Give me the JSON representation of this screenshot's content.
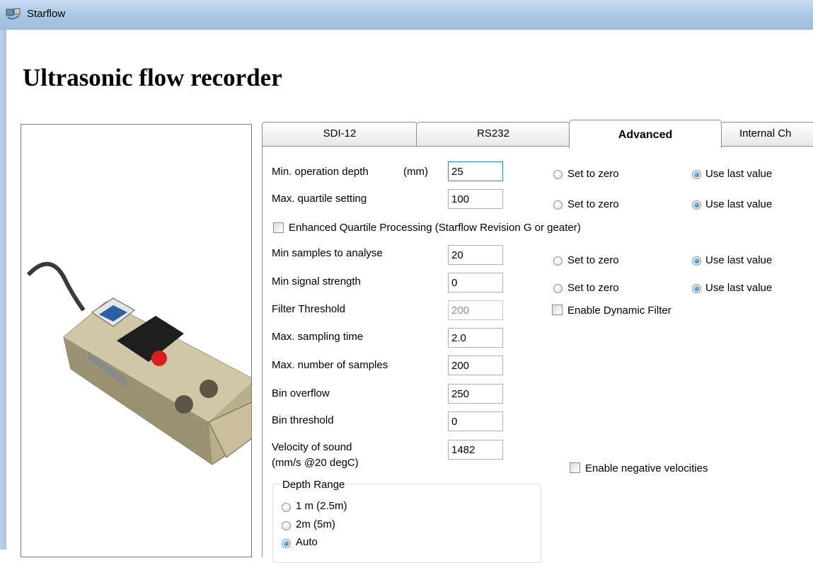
{
  "window": {
    "title": "Starflow"
  },
  "page": {
    "heading": "Ultrasonic flow recorder"
  },
  "tabs": [
    {
      "label": "SDI-12"
    },
    {
      "label": "RS232"
    },
    {
      "label": "Advanced"
    },
    {
      "label": "Internal Ch"
    }
  ],
  "form": {
    "min_operation_depth": {
      "label": "Min. operation depth",
      "unit": "(mm)",
      "value": "25"
    },
    "max_quartile_setting": {
      "label": "Max. quartile setting",
      "value": "100"
    },
    "enhanced_quartile": {
      "label": "Enhanced Quartile Processing (Starflow Revision G or geater)",
      "checked": false
    },
    "min_samples": {
      "label": "Min samples to analyse",
      "value": "20"
    },
    "min_signal": {
      "label": "Min signal strength",
      "value": "0"
    },
    "filter_threshold": {
      "label": "Filter Threshold",
      "value": "200"
    },
    "dynamic_filter": {
      "label": "Enable Dynamic Filter",
      "checked": false
    },
    "max_sampling_time": {
      "label": "Max. sampling time",
      "value": "2.0"
    },
    "max_samples": {
      "label": "Max. number of samples",
      "value": "200"
    },
    "bin_overflow": {
      "label": "Bin overflow",
      "value": "250"
    },
    "bin_threshold": {
      "label": "Bin threshold",
      "value": "0"
    },
    "velocity_of_sound": {
      "label_line1": "Velocity of sound",
      "label_line2": "(mm/s @20 degC)",
      "value": "1482"
    },
    "negative_velocities": {
      "label": "Enable negative velocities",
      "checked": false
    },
    "option_set_zero": "Set to zero",
    "option_use_last": "Use last value"
  },
  "depth_range": {
    "title": "Depth Range",
    "options": [
      "1 m (2.5m)",
      "2m (5m)",
      "Auto"
    ],
    "selected": "Auto"
  }
}
